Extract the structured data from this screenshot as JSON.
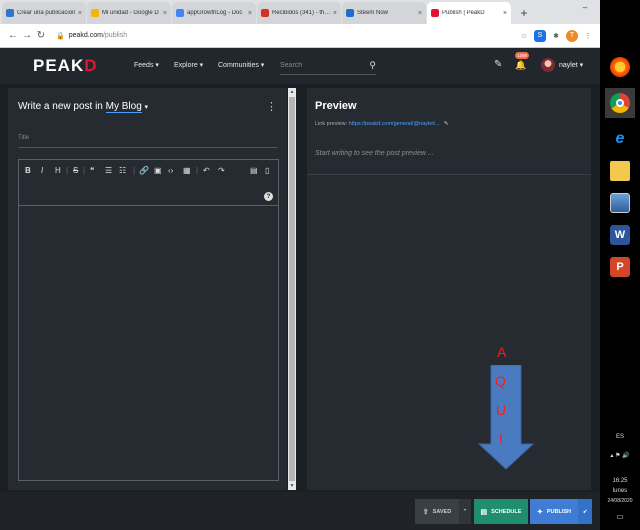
{
  "browser": {
    "tabs": [
      {
        "label": "Crear una publicación",
        "color": "#2f76c9",
        "active": false
      },
      {
        "label": "Mi unidad - Google D",
        "color": "#f4b400",
        "active": false
      },
      {
        "label": "appGrowthLog - Doc",
        "color": "#4285f4",
        "active": false
      },
      {
        "label": "Recibidos (341) - thun",
        "color": "#d93025",
        "active": false
      },
      {
        "label": "Steem Now",
        "color": "#1a6fd1",
        "active": false
      },
      {
        "label": "Publish | PeakD",
        "color": "#e31337",
        "active": true
      }
    ],
    "new_tab": "+",
    "window_buttons": {
      "minimize": "–",
      "maximize": "☐",
      "close": "✕"
    },
    "url_host": "peakd.com",
    "url_path": "/publish",
    "profile_initial": "T"
  },
  "header": {
    "logo_main": "PEAK",
    "logo_accent": "D",
    "nav": [
      "Feeds ▾",
      "Explore ▾",
      "Communities ▾"
    ],
    "search_placeholder": "Search",
    "notif_count": "1269",
    "username": "naylet ▾"
  },
  "editor": {
    "title_prefix": "Write a new post in ",
    "blog": "My Blog",
    "caret": "▾",
    "title_placeholder": "Title",
    "toolbar": [
      "B",
      "I",
      "H",
      "S",
      "❝",
      "☰",
      "☷",
      "🔗",
      "▣",
      "‹›",
      "▦",
      "↶",
      "↷",
      "▤",
      "▯"
    ],
    "help": "?"
  },
  "preview": {
    "heading": "Preview",
    "link_label": "Link preview: ",
    "link_url": "https://peakd.com/general/@naylet/...",
    "placeholder": "Start writing to see the post preview ..."
  },
  "annotation": {
    "letters": [
      "A",
      "Q",
      "U",
      "I"
    ],
    "color": "#ff1a1a"
  },
  "actions": {
    "saved": "SAVED",
    "schedule": "SCHEDULE",
    "publish": "PUBLISH"
  },
  "taskbar": {
    "language": "ES",
    "time": "16:25",
    "day": "lunes",
    "date": "24/08/2020"
  }
}
